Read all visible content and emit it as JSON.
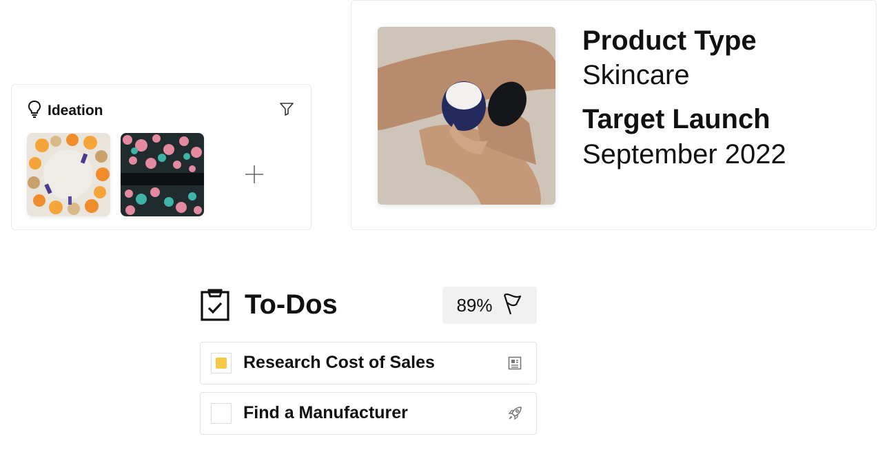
{
  "ideation": {
    "title": "Ideation",
    "icons": {
      "header": "lightbulb-icon",
      "filter": "filter-icon",
      "add": "plus-icon"
    }
  },
  "product": {
    "type_label": "Product Type",
    "type_value": "Skincare",
    "launch_label": "Target Launch",
    "launch_value": "September 2022"
  },
  "todos": {
    "title": "To-Dos",
    "progress": "89%",
    "progress_fraction": 0.89,
    "icons": {
      "header": "clipboard-check-icon",
      "progress": "flag-icon"
    },
    "items": [
      {
        "label": "Research Cost of Sales",
        "status": "in-progress",
        "icon": "document-icon"
      },
      {
        "label": "Find a Manufacturer",
        "status": "not-started",
        "icon": "rocket-icon"
      }
    ]
  },
  "colors": {
    "accent": "#f7c948",
    "badge_bg": "#f1f1f1",
    "border": "#e4e4e4"
  }
}
